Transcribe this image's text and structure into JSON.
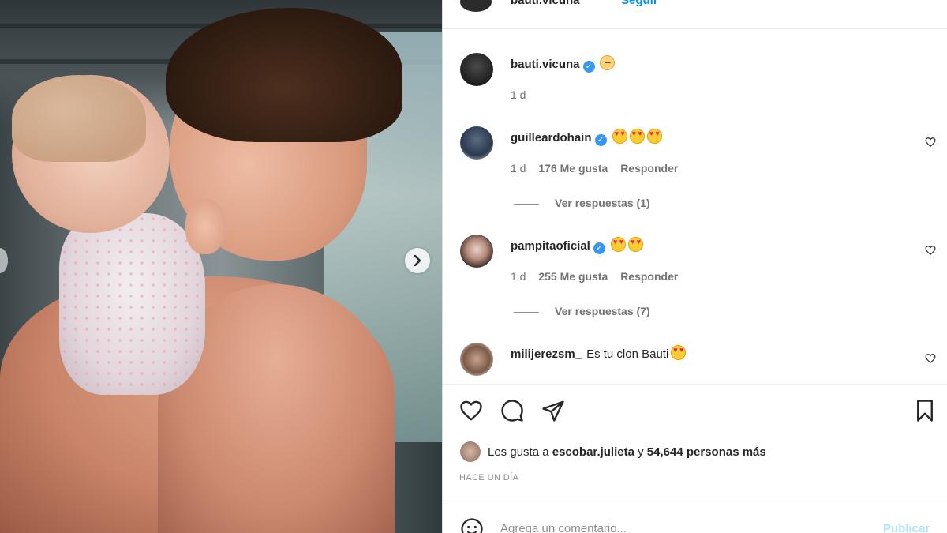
{
  "header": {
    "username": "bauti.vicuna",
    "follow_label": "Seguir"
  },
  "caption": {
    "username": "bauti.vicuna",
    "time": "1 d"
  },
  "comments": [
    {
      "username": "guilleardohain",
      "verified": true,
      "time": "1 d",
      "likes": "176 Me gusta",
      "reply": "Responder",
      "view_replies": "Ver respuestas (1)",
      "emoji_count": 3
    },
    {
      "username": "pampitaoficial",
      "verified": true,
      "time": "1 d",
      "likes": "255 Me gusta",
      "reply": "Responder",
      "view_replies": "Ver respuestas (7)",
      "emoji_count": 2
    },
    {
      "username": "milijerezsm_",
      "verified": false,
      "text": "Es tu clon Bauti",
      "emoji_count": 1
    }
  ],
  "likes": {
    "prefix": "Les gusta a ",
    "user": "escobar.julieta",
    "middle": " y ",
    "count": "54,644 personas más"
  },
  "timestamp": "HACE UN DÍA",
  "add_comment": {
    "placeholder": "Agrega un comentario...",
    "post_label": "Publicar"
  },
  "icons": [
    "heart-icon",
    "comment-icon",
    "share-icon",
    "bookmark-icon",
    "emoji-icon",
    "chevron-right-icon",
    "verified-badge-icon"
  ]
}
